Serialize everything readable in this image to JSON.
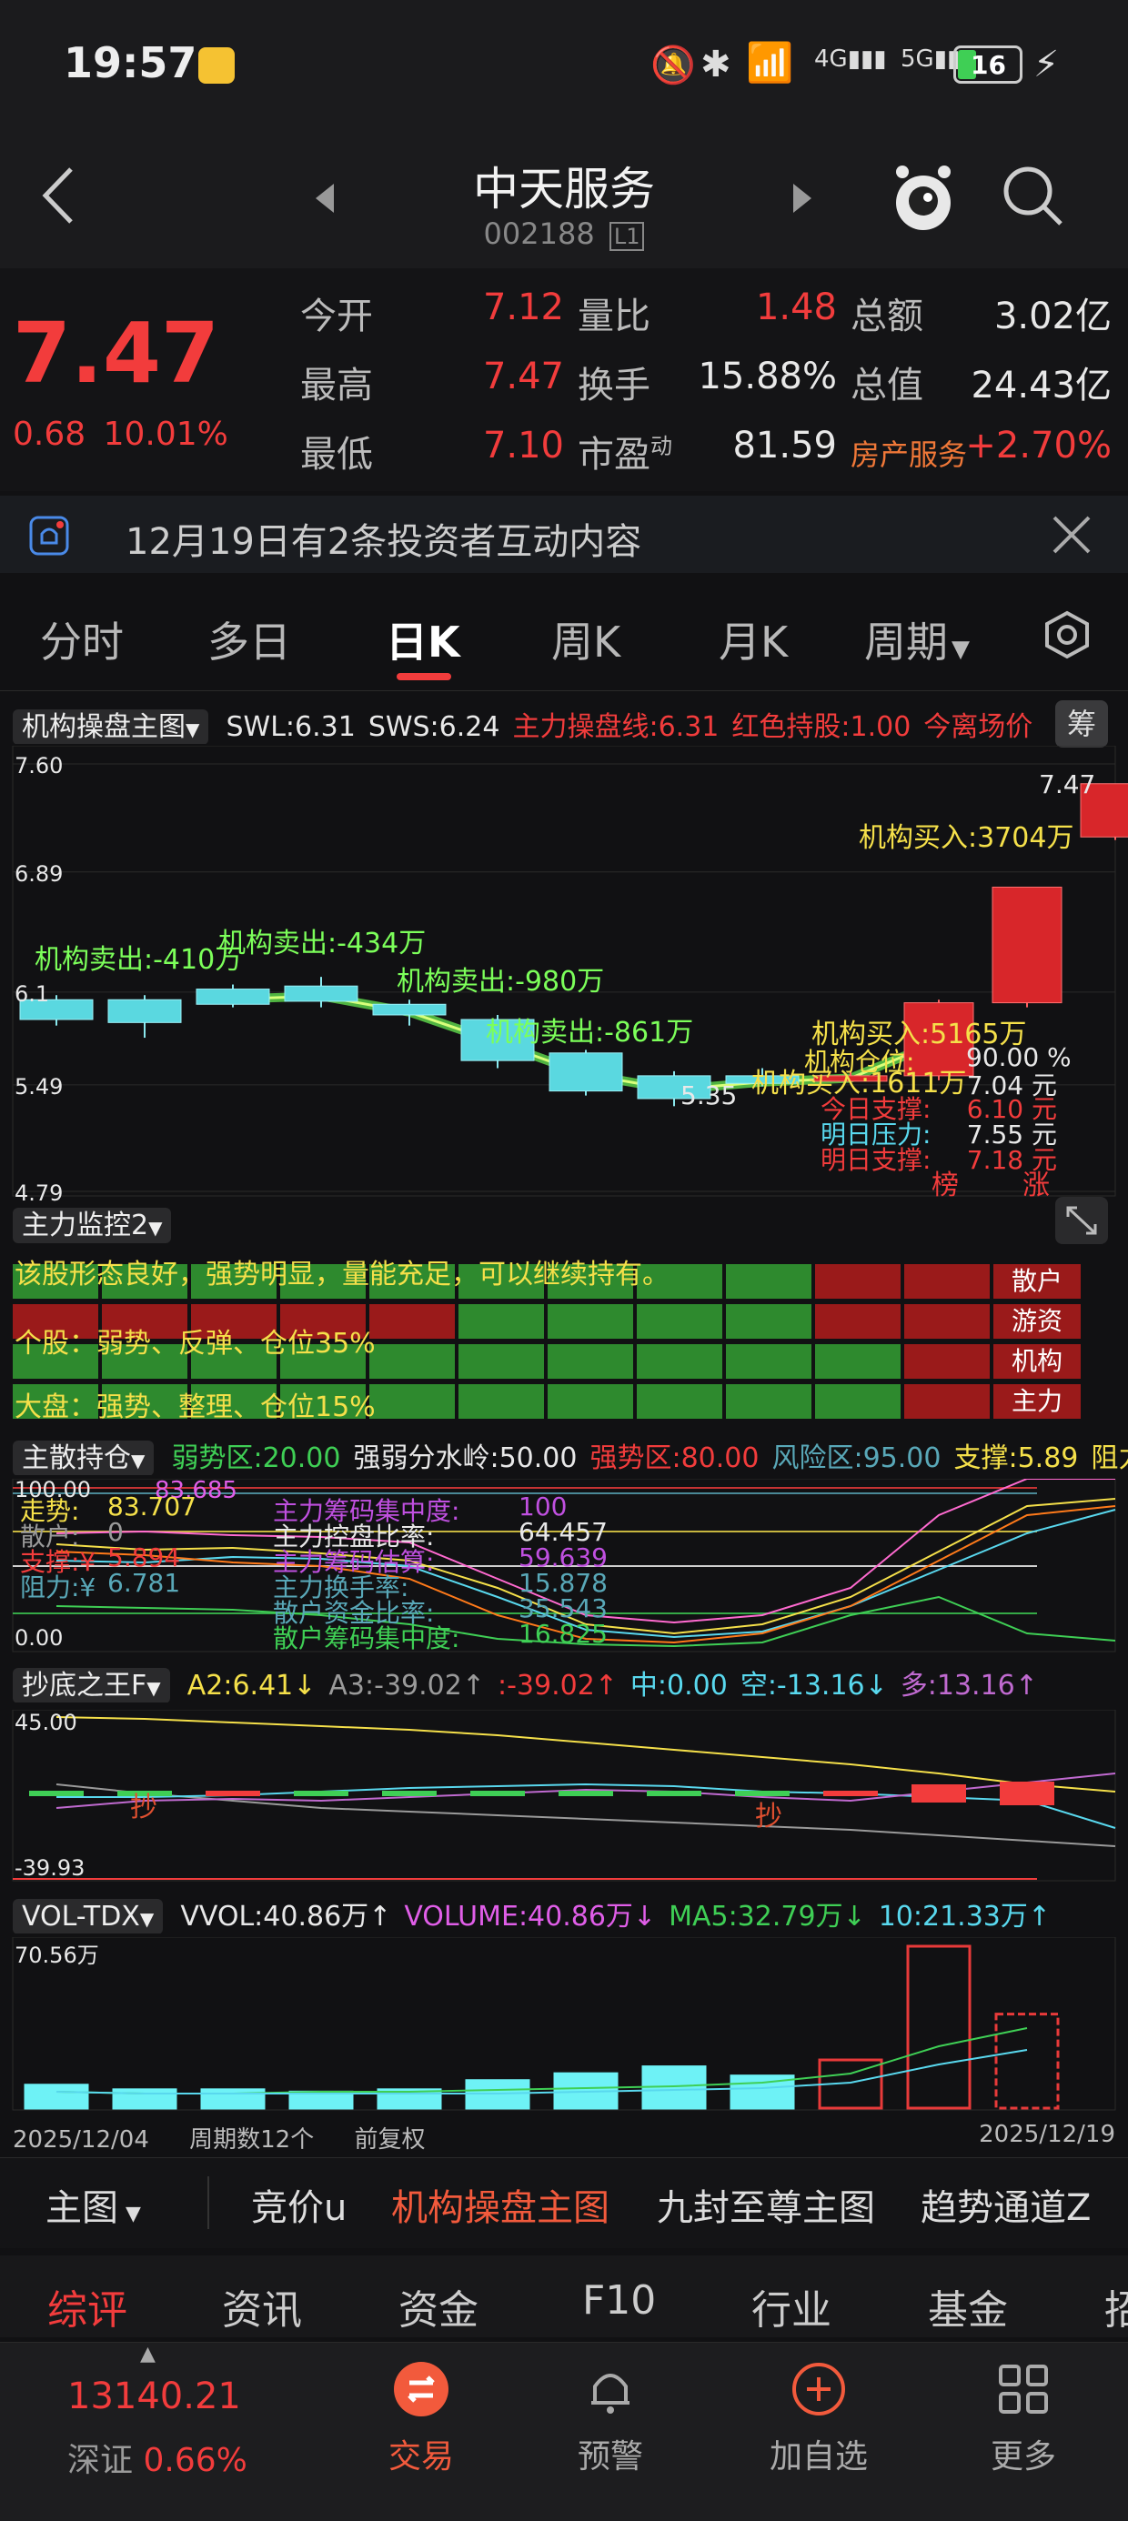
{
  "status": {
    "time": "19:57",
    "battery": "16"
  },
  "header": {
    "title": "中天服务",
    "code": "002188",
    "level": "L1"
  },
  "quote": {
    "price": "7.47",
    "change": "0.68",
    "change_pct": "10.01%",
    "rows": [
      [
        {
          "label": "今开",
          "value": "7.12"
        },
        {
          "label": "量比",
          "value": "1.48"
        },
        {
          "label": "总额",
          "value": "3.02亿"
        }
      ],
      [
        {
          "label": "最高",
          "value": "7.47"
        },
        {
          "label": "换手",
          "value": "15.88%"
        },
        {
          "label": "总值",
          "value": "24.43亿"
        }
      ],
      [
        {
          "label": "最低",
          "value": "7.10"
        },
        {
          "label": "市盈",
          "sup": "动",
          "value": "81.59"
        },
        {
          "label": "房产服务",
          "value": "+2.70%"
        }
      ]
    ]
  },
  "notice": {
    "text": "12月19日有2条投资者互动内容"
  },
  "tabs": [
    "分时",
    "多日",
    "日K",
    "周K",
    "月K",
    "周期"
  ],
  "main_panel": {
    "selector": "机构操盘主图",
    "badge": "筹",
    "indicators": [
      {
        "text": "SWL:6.31",
        "color": "#e8e8e8"
      },
      {
        "text": "SWS:6.24",
        "color": "#e8e8e8"
      },
      {
        "text": "主力操盘线:6.31",
        "color": "#f23c3c"
      },
      {
        "text": "红色持股:1.00",
        "color": "#f23c3c"
      },
      {
        "text": "今离场价",
        "color": "#f23c3c"
      }
    ],
    "yticks": [
      "7.60",
      "6.89",
      "6.1",
      "5.49",
      "4.79"
    ],
    "annotations": {
      "sell1": "机构卖出:-410万",
      "sell2": "机构卖出:-434万",
      "sell3": "机构卖出:-980万",
      "sell4": "机构卖出:-861万",
      "buy1": "机构买入:3704万",
      "buy2": "机构买入:5165万",
      "buy3": "机构买入:1611万",
      "high": "7.47",
      "low": "5.35",
      "pos_label": "机构仓位:",
      "pos_value": "90.00 %",
      "s1_label": "今日支撑:",
      "s1_value": "6.10 元",
      "p1_label": "明日压力:",
      "p1_value": "7.55 元",
      "s2_label": "明日支撑:",
      "s2_value": "7.18 元",
      "p0_value": "7.04 元",
      "tag1": "榜",
      "tag2": "涨"
    }
  },
  "monitor": {
    "selector": "主力监控2",
    "line1": "该股形态良好，强势明显，量能充足，可以继续持有。",
    "line2": "个股：弱势、反弹、仓位35%",
    "line3": "大盘：强势、整理、仓位15%",
    "labels": [
      "散户",
      "游资",
      "机构",
      "主力"
    ]
  },
  "hold": {
    "selector": "主散持仓",
    "indicators": [
      {
        "text": "弱势区:20.00",
        "color": "#3fcf55"
      },
      {
        "text": "强弱分水岭:50.00",
        "color": "#e8e8e8"
      },
      {
        "text": "强势区:80.00",
        "color": "#f23c3c"
      },
      {
        "text": "风险区:95.00",
        "color": "#59a8b8"
      },
      {
        "text": "支撑:5.89",
        "color": "#f5e04a"
      },
      {
        "text": "阻力",
        "color": "#f5e04a"
      }
    ],
    "yticks": [
      "100.00",
      "0.00"
    ],
    "rows": [
      {
        "label": "走势:",
        "value": "83.707",
        "label2": "主力筹码集中度:",
        "value2": "100"
      },
      {
        "label": "散户:",
        "value": "0",
        "label2": "主力控盘比率:",
        "value2": "64.457"
      },
      {
        "label": "支撑:¥",
        "value": "5.894",
        "label2": "主力筹码估算:",
        "value2": "59.639"
      },
      {
        "label": "阻力:¥",
        "value": "6.781",
        "label2": "主力换手率:",
        "value2": "15.878"
      },
      {
        "label": "",
        "value": "",
        "label2": "散户资金比率:",
        "value2": "35.543"
      },
      {
        "label": "",
        "value": "",
        "label2": "散户筹码集中度:",
        "value2": "16.825"
      }
    ],
    "extra": "83.685"
  },
  "bottom_panel": {
    "selector": "抄底之王F",
    "indicators": [
      {
        "text": "A2:6.41↓",
        "color": "#f5e04a"
      },
      {
        "text": "A3:-39.02↑",
        "color": "#9a9a9a"
      },
      {
        "text": ":-39.02↑",
        "color": "#f23c3c"
      },
      {
        "text": "中:0.00",
        "color": "#59d8ee"
      },
      {
        "text": "空:-13.16↓",
        "color": "#59d8ee"
      },
      {
        "text": "多:13.16↑",
        "color": "#c06ad0"
      }
    ],
    "yticks": [
      "45.00",
      "-39.93"
    ],
    "mark": "抄"
  },
  "vol_panel": {
    "selector": "VOL-TDX",
    "indicators": [
      {
        "text": "VVOL:40.86万↑",
        "color": "#e8e8e8"
      },
      {
        "text": "VOLUME:40.86万↓",
        "color": "#e05ee8"
      },
      {
        "text": "MA5:32.79万↓",
        "color": "#3fcf55"
      },
      {
        "text": "10:21.33万↑",
        "color": "#59d8ee"
      }
    ],
    "ymax": "70.56万",
    "date_start": "2025/12/04",
    "period_count": "周期数12个",
    "adjust": "前复权",
    "date_end": "2025/12/19"
  },
  "chart_selector": {
    "main": "主图",
    "items": [
      "竞价u",
      "机构操盘主图",
      "九封至尊主图",
      "趋势通道Z"
    ]
  },
  "section_tabs": [
    "综评",
    "资讯",
    "资金",
    "F10",
    "行业",
    "基金",
    "招"
  ],
  "bottombar": {
    "index_value": "13140.21",
    "index_name": "深证",
    "index_pct": "0.66%",
    "items": [
      "交易",
      "预警",
      "加自选",
      "更多"
    ]
  },
  "chart_data": {
    "type": "candlestick",
    "yticks": [
      7.6,
      6.89,
      6.1,
      5.49,
      4.79
    ],
    "ylim": [
      4.79,
      7.6
    ],
    "candles": [
      {
        "o": 6.05,
        "c": 5.92,
        "h": 6.08,
        "l": 5.88
      },
      {
        "o": 6.05,
        "c": 5.9,
        "h": 6.08,
        "l": 5.8
      },
      {
        "o": 6.12,
        "c": 6.02,
        "h": 6.15,
        "l": 6.0
      },
      {
        "o": 6.14,
        "c": 6.04,
        "h": 6.2,
        "l": 6.0
      },
      {
        "o": 6.02,
        "c": 5.95,
        "h": 6.05,
        "l": 5.88
      },
      {
        "o": 5.92,
        "c": 5.65,
        "h": 5.95,
        "l": 5.6
      },
      {
        "o": 5.7,
        "c": 5.45,
        "h": 5.72,
        "l": 5.42
      },
      {
        "o": 5.55,
        "c": 5.4,
        "h": 5.58,
        "l": 5.35
      },
      {
        "o": 5.55,
        "c": 5.5,
        "h": 5.6,
        "l": 5.48
      },
      {
        "o": 5.55,
        "c": 5.55,
        "h": 5.58,
        "l": 5.52
      },
      {
        "o": 5.55,
        "c": 6.03,
        "h": 6.05,
        "l": 5.52
      },
      {
        "o": 6.03,
        "c": 6.79,
        "h": 6.79,
        "l": 6.0
      },
      {
        "o": 7.12,
        "c": 7.47,
        "h": 7.47,
        "l": 7.1
      }
    ],
    "volumes": [
      10,
      8,
      8,
      7,
      8,
      12,
      15,
      18,
      14,
      21,
      70.56,
      41
    ],
    "vol_ylim": [
      0,
      70.56
    ]
  }
}
